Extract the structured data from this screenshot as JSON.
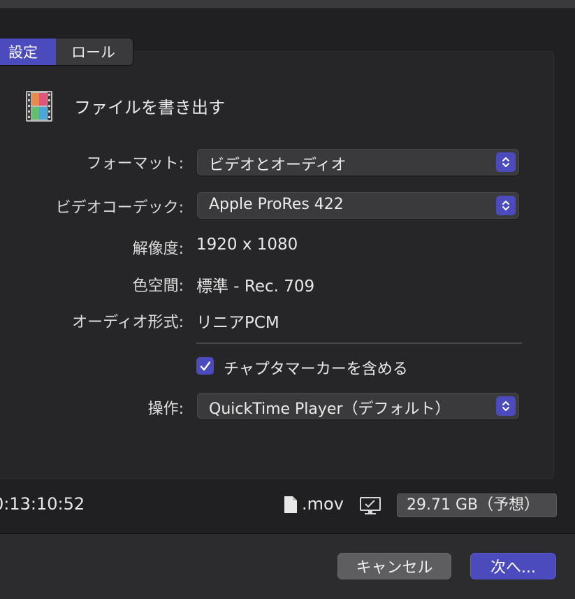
{
  "tabs": {
    "settings": "設定",
    "roles": "ロール"
  },
  "header": {
    "title": "ファイルを書き出す",
    "icon": "film-strip-icon"
  },
  "fields": {
    "format": {
      "label": "フォーマット:",
      "value": "ビデオとオーディオ"
    },
    "codec": {
      "label": "ビデオコーデック:",
      "value": "Apple ProRes 422"
    },
    "resolution": {
      "label": "解像度:",
      "value": "1920 x 1080"
    },
    "color_space": {
      "label": "色空間:",
      "value": "標準 - Rec. 709"
    },
    "audio_format": {
      "label": "オーディオ形式:",
      "value": "リニアPCM"
    },
    "chapter_markers": {
      "label": "チャプタマーカーを含める",
      "checked": true
    },
    "action": {
      "label": "操作:",
      "value": "QuickTime Player（デフォルト）"
    }
  },
  "status": {
    "timecode": "0:13:10:52",
    "extension": ".mov",
    "estimated_size": "29.71 GB（予想）"
  },
  "buttons": {
    "cancel": "キャンセル",
    "next": "次へ..."
  },
  "colors": {
    "accent": "#4b4bbe",
    "background": "#262628"
  }
}
